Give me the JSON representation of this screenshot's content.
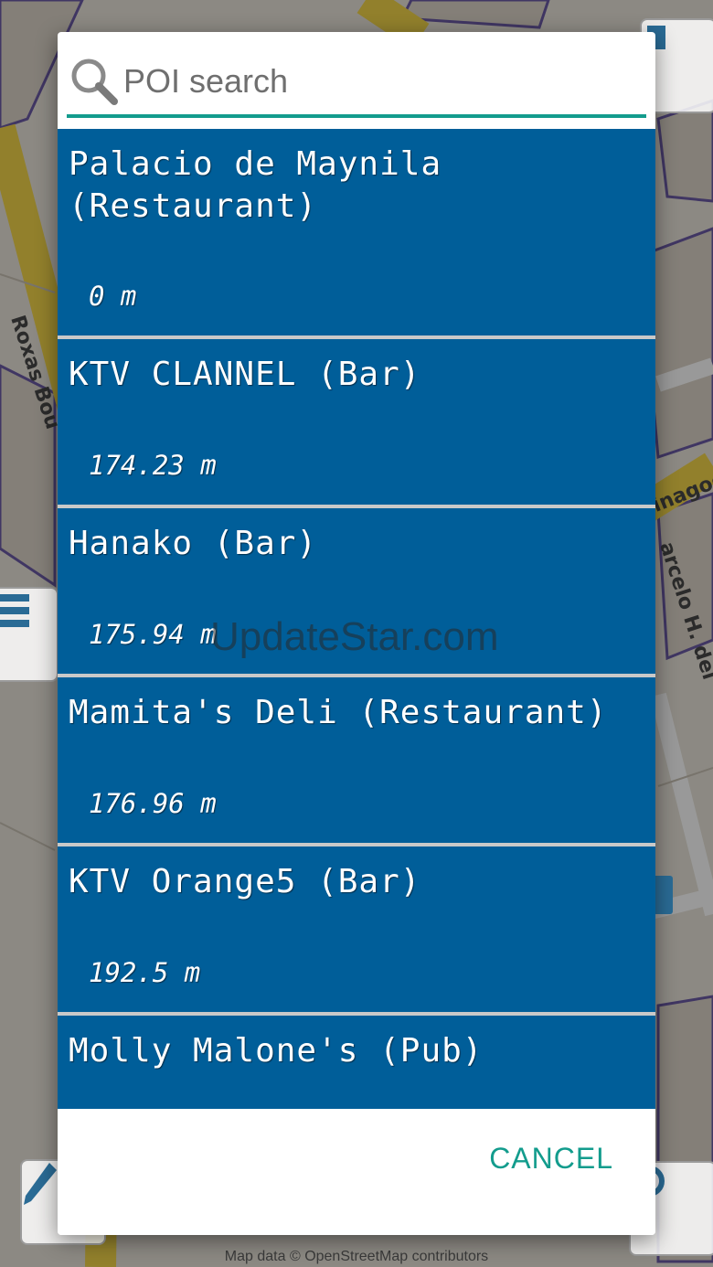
{
  "map": {
    "road_labels": [
      "Roxas Bou",
      "inagoo",
      "arcelo H. del"
    ],
    "attribution": "Map data © OpenStreetMap contributors"
  },
  "search": {
    "placeholder": "POI search",
    "value": ""
  },
  "results": [
    {
      "name": "Palacio de Maynila\n(Restaurant)",
      "distance": "0 m"
    },
    {
      "name": "KTV CLANNEL (Bar)",
      "distance": "174.23 m"
    },
    {
      "name": "Hanako (Bar)",
      "distance": "175.94 m"
    },
    {
      "name": "Mamita's Deli (Restaurant)",
      "distance": "176.96 m"
    },
    {
      "name": "KTV Orange5 (Bar)",
      "distance": "192.5 m"
    },
    {
      "name": "Molly Malone's (Pub)",
      "distance": ""
    }
  ],
  "dialog": {
    "cancel_label": "CANCEL"
  },
  "watermark": "UpdateStar.com",
  "colors": {
    "accent": "#139c8d",
    "result_bg": "#005e99"
  }
}
